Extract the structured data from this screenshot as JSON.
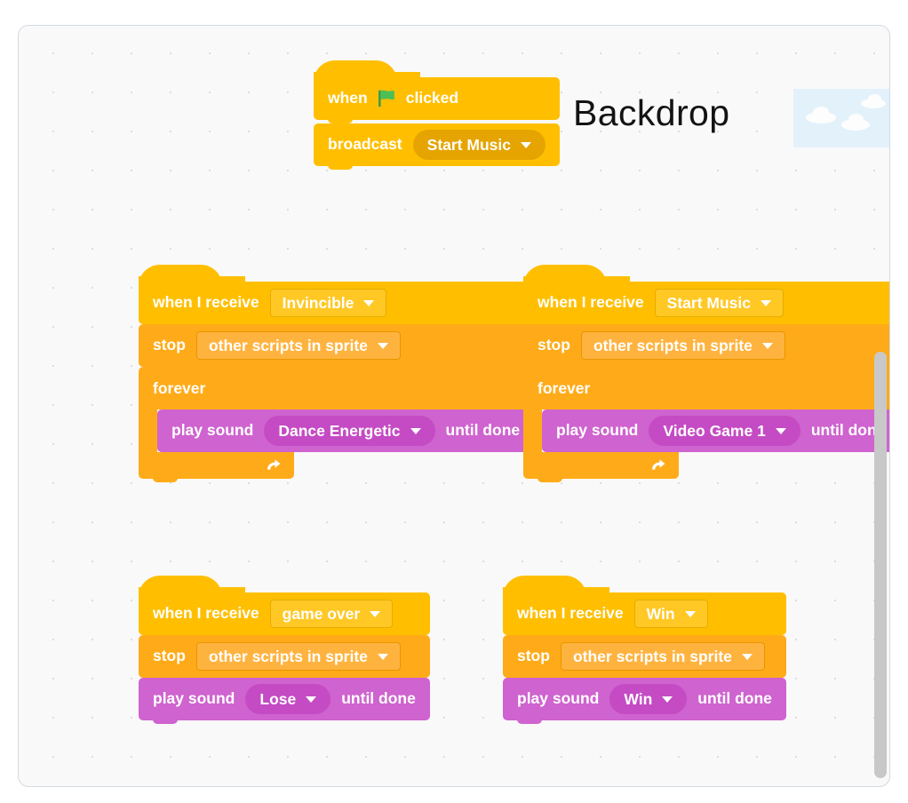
{
  "workspace": {
    "watermark": "Backdrop",
    "backdrop_thumbnail": "sky-with-clouds-thumbnail",
    "background_color": "#f9f9f9",
    "grid": "dot-grid"
  },
  "colors": {
    "events": "#ffbf00",
    "control": "#ffab19",
    "sound": "#cf63cf",
    "sound_field": "#c44bc4",
    "border": "#d4dae3",
    "flag_green": "#4cbf56"
  },
  "scripts": [
    {
      "id": "script-start",
      "blocks": [
        {
          "type": "hat",
          "prefix": "when",
          "icon": "green-flag-icon",
          "suffix": "clicked"
        },
        {
          "type": "stack",
          "prefix": "broadcast",
          "field": "Start Music",
          "field_style": "rect"
        }
      ]
    },
    {
      "id": "script-invincible",
      "blocks": [
        {
          "type": "hat",
          "prefix": "when I receive",
          "field": "Invincible"
        },
        {
          "type": "stack",
          "prefix": "stop",
          "field": "other scripts in sprite"
        },
        {
          "type": "c",
          "prefix": "forever",
          "inner": {
            "prefix": "play sound",
            "field": "Dance Energetic",
            "suffix": "until done"
          }
        }
      ]
    },
    {
      "id": "script-start-music",
      "blocks": [
        {
          "type": "hat",
          "prefix": "when I receive",
          "field": "Start Music"
        },
        {
          "type": "stack",
          "prefix": "stop",
          "field": "other scripts in sprite"
        },
        {
          "type": "c",
          "prefix": "forever",
          "inner": {
            "prefix": "play sound",
            "field": "Video Game 1",
            "suffix": "until done"
          }
        }
      ]
    },
    {
      "id": "script-game-over",
      "blocks": [
        {
          "type": "hat",
          "prefix": "when I receive",
          "field": "game over"
        },
        {
          "type": "stack",
          "prefix": "stop",
          "field": "other scripts in sprite"
        },
        {
          "type": "sound",
          "prefix": "play sound",
          "field": "Lose",
          "suffix": "until done"
        }
      ]
    },
    {
      "id": "script-win",
      "blocks": [
        {
          "type": "hat",
          "prefix": "when I receive",
          "field": "Win"
        },
        {
          "type": "stack",
          "prefix": "stop",
          "field": "other scripts in sprite"
        },
        {
          "type": "sound",
          "prefix": "play sound",
          "field": "Win",
          "suffix": "until done"
        }
      ]
    }
  ],
  "s1": {
    "b1_prefix": "when",
    "b1_suffix": "clicked",
    "b2_prefix": "broadcast",
    "b2_field": "Start Music"
  },
  "s2": {
    "b1_prefix": "when I receive",
    "b1_field": "Invincible",
    "b2_prefix": "stop",
    "b2_field": "other scripts in sprite",
    "b3_prefix": "forever",
    "b4_prefix": "play sound",
    "b4_field": "Dance Energetic",
    "b4_suffix": "until done"
  },
  "s3": {
    "b1_prefix": "when I receive",
    "b1_field": "Start Music",
    "b2_prefix": "stop",
    "b2_field": "other scripts in sprite",
    "b3_prefix": "forever",
    "b4_prefix": "play sound",
    "b4_field": "Video Game 1",
    "b4_suffix": "until done"
  },
  "s4": {
    "b1_prefix": "when I receive",
    "b1_field": "game over",
    "b2_prefix": "stop",
    "b2_field": "other scripts in sprite",
    "b3_prefix": "play sound",
    "b3_field": "Lose",
    "b3_suffix": "until done"
  },
  "s5": {
    "b1_prefix": "when I receive",
    "b1_field": "Win",
    "b2_prefix": "stop",
    "b2_field": "other scripts in sprite",
    "b3_prefix": "play sound",
    "b3_field": "Win",
    "b3_suffix": "until done"
  },
  "scrollbar": {
    "orientation": "vertical",
    "name": "vertical-scrollbar"
  }
}
